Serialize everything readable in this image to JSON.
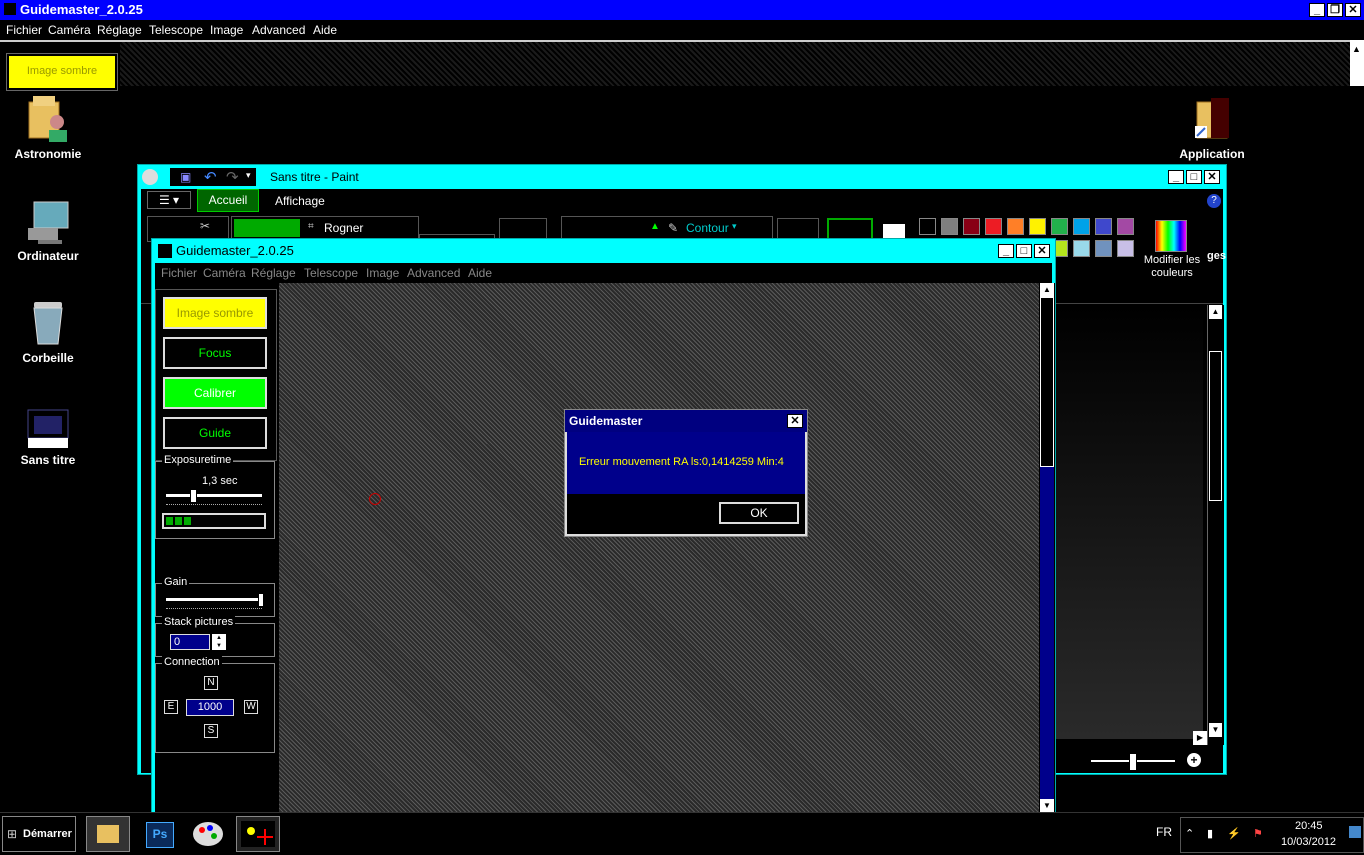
{
  "outer_window": {
    "title": "Guidemaster_2.0.25",
    "menu": [
      "Fichier",
      "Caméra",
      "Réglage",
      "Telescope",
      "Image",
      "Advanced",
      "Aide"
    ],
    "tab_label": "Image sombre"
  },
  "desktop": {
    "icons": [
      {
        "label": "Astronomie",
        "icon": "user-folder-icon"
      },
      {
        "label": "Ordinateur",
        "icon": "computer-icon"
      },
      {
        "label": "Corbeille",
        "icon": "recycle-bin-icon"
      },
      {
        "label": "Sans titre",
        "icon": "image-file-icon"
      },
      {
        "label": "Application",
        "icon": "folder-shortcut-icon"
      }
    ]
  },
  "paint": {
    "title": "Sans titre - Paint",
    "tabs": [
      "Accueil",
      "Affichage"
    ],
    "rogner": "Rogner",
    "contour": "Contour",
    "modifier_couleurs": "Modifier les couleurs",
    "images_fragment": "ges",
    "colors_row1": [
      "#000000",
      "#7f7f7f",
      "#880015",
      "#ed1c24",
      "#ff7f27",
      "#fff200",
      "#22b14c",
      "#00a2e8",
      "#3f48cc",
      "#a349a4"
    ],
    "colors_row2": [
      "#ffffff",
      "#c3c3c3",
      "#b97a57",
      "#ffaec9",
      "#ffc90e",
      "#efe4b0",
      "#b5e61d",
      "#99d9ea",
      "#7092be",
      "#c8bfe7"
    ]
  },
  "guidemaster": {
    "title": "Guidemaster_2.0.25",
    "menu": [
      "Fichier",
      "Caméra",
      "Réglage",
      "Telescope",
      "Image",
      "Advanced",
      "Aide"
    ],
    "buttons": {
      "image_sombre": "Image sombre",
      "focus": "Focus",
      "calibrer": "Calibrer",
      "guide": "Guide"
    },
    "exposure": {
      "label": "Exposuretime",
      "value": "1,3 sec",
      "progress_bars": 3
    },
    "gain": {
      "label": "Gain"
    },
    "stack": {
      "label": "Stack pictures",
      "value": "0"
    },
    "connection": {
      "label": "Connection",
      "n": "N",
      "e": "E",
      "w": "W",
      "s": "S",
      "value": "1000"
    }
  },
  "dialog": {
    "title": "Guidemaster",
    "message": "Erreur mouvement RA ls:0,1414259 Min:4",
    "ok": "OK"
  },
  "taskbar": {
    "start": "Démarrer",
    "lang": "FR",
    "time": "20:45",
    "date": "10/03/2012"
  },
  "colors": {
    "title_blue": "#0000ff",
    "cyan": "#00ffff",
    "yellow": "#ffff00",
    "green": "#00ff00",
    "dialog_navy": "#00008b"
  }
}
